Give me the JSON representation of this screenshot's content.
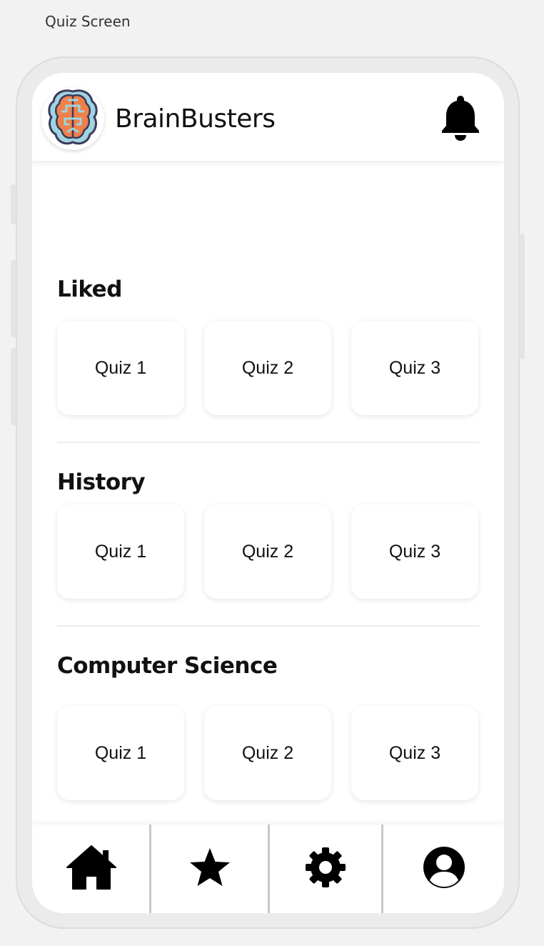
{
  "frame_label": "Quiz Screen",
  "header": {
    "app_name": "BrainBusters",
    "logo_icon": "brain-icon",
    "notification_icon": "bell-icon"
  },
  "sections": [
    {
      "title": "Liked",
      "quizzes": [
        {
          "label": "Quiz 1"
        },
        {
          "label": "Quiz 2"
        },
        {
          "label": "Quiz 3"
        }
      ]
    },
    {
      "title": "History",
      "quizzes": [
        {
          "label": "Quiz 1"
        },
        {
          "label": "Quiz 2"
        },
        {
          "label": "Quiz 3"
        }
      ]
    },
    {
      "title": "Computer Science",
      "quizzes": [
        {
          "label": "Quiz 1"
        },
        {
          "label": "Quiz 2"
        },
        {
          "label": "Quiz 3"
        }
      ]
    }
  ],
  "bottom_nav": [
    {
      "icon": "home-icon"
    },
    {
      "icon": "star-icon"
    },
    {
      "icon": "gear-icon"
    },
    {
      "icon": "profile-icon"
    }
  ],
  "colors": {
    "page_background": "#f2f2f2",
    "screen_background": "#ffffff",
    "logo_orange": "#f0804a",
    "logo_blue": "#9fd4e0",
    "logo_outline": "#3a3a5c"
  }
}
